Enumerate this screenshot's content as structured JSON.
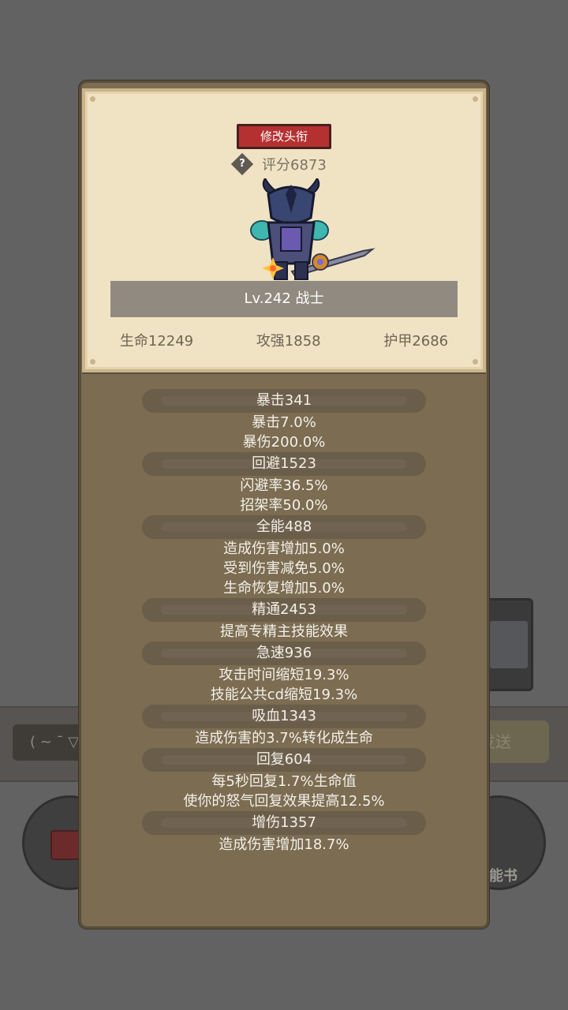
{
  "background": {
    "input_text": "( ~ ¯ ▽",
    "send_label": "发送",
    "book_label": "能书"
  },
  "card": {
    "rename_button": "修改头衔",
    "help_icon": "?",
    "score": "评分6873",
    "name_level": "Lv.242 战士",
    "stats": [
      {
        "text": "生命12249"
      },
      {
        "text": "攻强1858"
      },
      {
        "text": "护甲2686"
      }
    ]
  },
  "stat_groups": [
    {
      "header": "暴击341",
      "lines": [
        "暴击7.0%",
        "暴伤200.0%"
      ]
    },
    {
      "header": "回避1523",
      "lines": [
        "闪避率36.5%",
        "招架率50.0%"
      ]
    },
    {
      "header": "全能488",
      "lines": [
        "造成伤害增加5.0%",
        "受到伤害减免5.0%",
        "生命恢复增加5.0%"
      ]
    },
    {
      "header": "精通2453",
      "lines": [
        "提高专精主技能效果"
      ]
    },
    {
      "header": "急速936",
      "lines": [
        "攻击时间缩短19.3%",
        "技能公共cd缩短19.3%"
      ]
    },
    {
      "header": "吸血1343",
      "lines": [
        "造成伤害的3.7%转化成生命"
      ]
    },
    {
      "header": "回复604",
      "lines": [
        "每5秒回复1.7%生命值",
        "使你的怒气回复效果提高12.5%"
      ]
    },
    {
      "header": "增伤1357",
      "lines": [
        "造成伤害增加18.7%"
      ]
    }
  ],
  "colors": {
    "overlay": "#626262",
    "modal": "#7b6c52",
    "card": "#f0e3c4",
    "rename_button": "#b53131",
    "name_bar": "#908a80"
  }
}
